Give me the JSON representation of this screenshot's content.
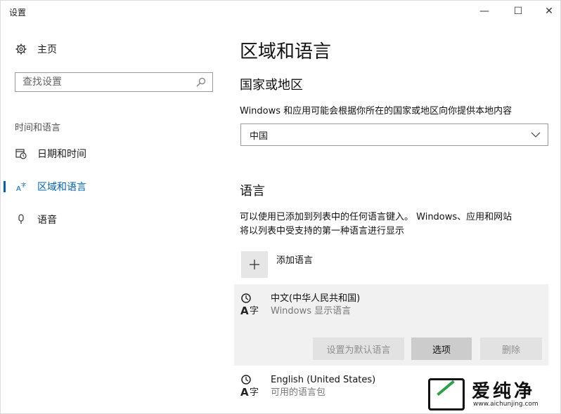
{
  "window": {
    "title": "设置",
    "minimize_glyph": "—",
    "maximize_glyph": "☐",
    "close_glyph": "✕"
  },
  "sidebar": {
    "home": {
      "icon": "gear-icon",
      "label": "主页"
    },
    "search": {
      "placeholder": "查找设置",
      "value": "",
      "icon": "search-icon"
    },
    "section_label": "时间和语言",
    "items": [
      {
        "icon": "calendar-clock-icon",
        "label": "日期和时间",
        "selected": false
      },
      {
        "icon": "region-language-icon",
        "label": "区域和语言",
        "selected": true
      },
      {
        "icon": "microphone-icon",
        "label": "语音",
        "selected": false
      }
    ]
  },
  "main": {
    "title": "区域和语言",
    "country_heading": "国家或地区",
    "country_desc": "Windows 和应用可能会根据你所在的国家或地区向你提供本地内容",
    "country_selected": "中国",
    "language_heading": "语言",
    "language_desc_line1": "可以使用已添加到列表中的任何语言键入。 Windows、应用和网站",
    "language_desc_line2": "将以列表中受支持的第一种语言进行显示",
    "add_language": {
      "label": "添加语言",
      "icon": "plus-icon"
    },
    "languages": [
      {
        "name": "中文(中华人民共和国)",
        "sub": "Windows 显示语言",
        "icon": "language-icon"
      },
      {
        "name": "English (United States)",
        "sub": "可用的语言包",
        "icon": "language-icon"
      }
    ],
    "buttons": {
      "set_default": "设置为默认语言",
      "options": "选项",
      "remove": "删除"
    }
  },
  "watermark": {
    "brand": "爱纯净",
    "url": "www.aichunjing.com"
  },
  "colors": {
    "accent": "#0063b1",
    "card_bg": "#f1f1f1",
    "watermark_green": "#2aa14a"
  }
}
